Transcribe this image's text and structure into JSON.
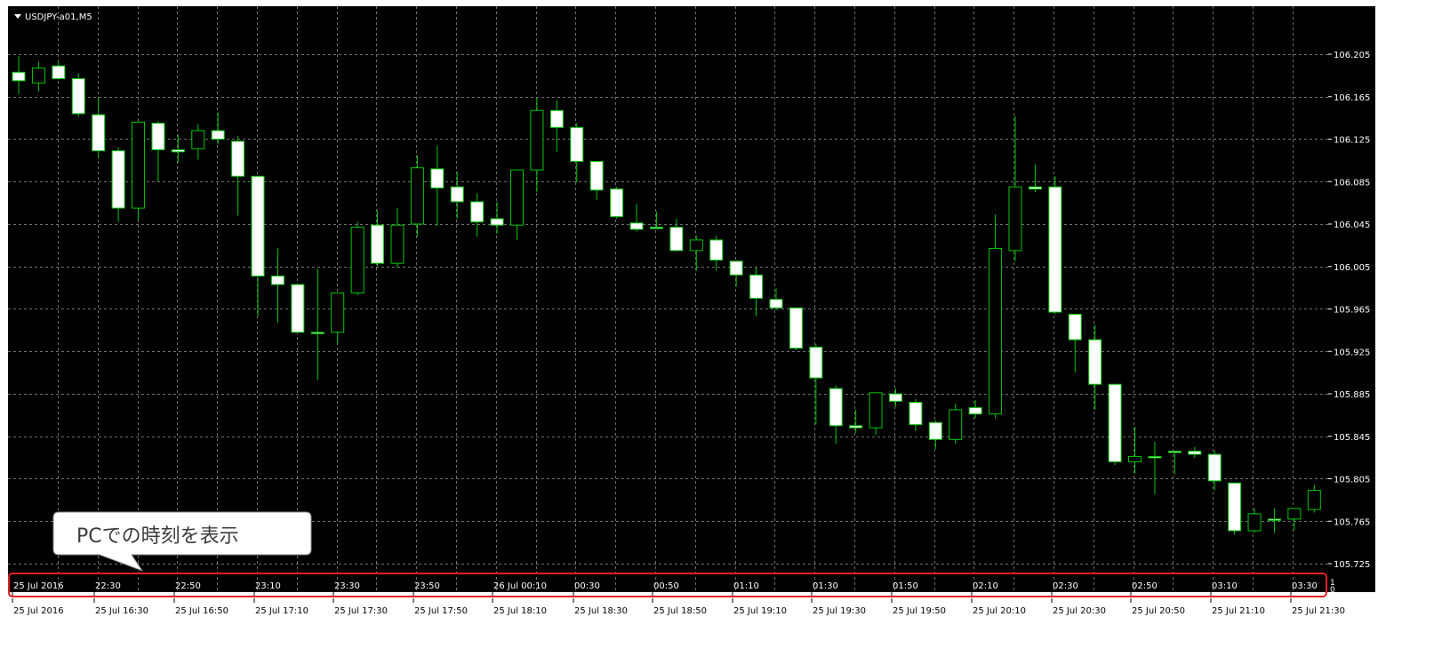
{
  "window": {
    "title": "USDJPY-a01,M5"
  },
  "callout": {
    "text": "PCでの時刻を表示"
  },
  "colors": {
    "background": "#000000",
    "grid": "#6f6f6f",
    "candle_up_body": "#000000",
    "candle_down_body": "#ffffff",
    "candle_outline": "#00c800",
    "highlight": "#e02020",
    "axis_text": "#ffffff",
    "bottom_text": "#000000"
  },
  "subwindow_scale": [
    "1",
    "0"
  ],
  "chart_data": {
    "type": "candlestick",
    "symbol": "USDJPY-a01",
    "timeframe": "M5",
    "grid": true,
    "y_tick_labels": [
      "106.205",
      "106.165",
      "106.125",
      "106.085",
      "106.045",
      "106.005",
      "105.965",
      "105.925",
      "105.885",
      "105.845",
      "105.805",
      "105.765",
      "105.725"
    ],
    "ylim": [
      105.721,
      106.219
    ],
    "pc_time_labels": [
      "25 Jul 2016",
      "22:30",
      "22:50",
      "23:10",
      "23:30",
      "23:50",
      "26 Jul 00:10",
      "00:30",
      "00:50",
      "01:10",
      "01:30",
      "01:50",
      "02:10",
      "02:30",
      "02:50",
      "03:10",
      "03:30"
    ],
    "server_time_labels": [
      "25 Jul 2016",
      "25 Jul 16:30",
      "25 Jul 16:50",
      "25 Jul 17:10",
      "25 Jul 17:30",
      "25 Jul 17:50",
      "25 Jul 18:10",
      "25 Jul 18:30",
      "25 Jul 18:50",
      "25 Jul 19:10",
      "25 Jul 19:30",
      "25 Jul 19:50",
      "25 Jul 20:10",
      "25 Jul 20:30",
      "25 Jul 20:50",
      "25 Jul 21:10",
      "25 Jul 21:30"
    ],
    "candles": [
      {
        "o": 106.188,
        "h": 106.203,
        "l": 106.167,
        "c": 106.18
      },
      {
        "o": 106.178,
        "h": 106.198,
        "l": 106.17,
        "c": 106.192
      },
      {
        "o": 106.194,
        "h": 106.198,
        "l": 106.181,
        "c": 106.182
      },
      {
        "o": 106.182,
        "h": 106.187,
        "l": 106.146,
        "c": 106.149
      },
      {
        "o": 106.148,
        "h": 106.164,
        "l": 106.107,
        "c": 106.114
      },
      {
        "o": 106.114,
        "h": 106.117,
        "l": 106.047,
        "c": 106.06
      },
      {
        "o": 106.06,
        "h": 106.142,
        "l": 106.049,
        "c": 106.141
      },
      {
        "o": 106.14,
        "h": 106.142,
        "l": 106.085,
        "c": 106.115
      },
      {
        "o": 106.115,
        "h": 106.129,
        "l": 106.103,
        "c": 106.113
      },
      {
        "o": 106.116,
        "h": 106.139,
        "l": 106.106,
        "c": 106.133
      },
      {
        "o": 106.133,
        "h": 106.15,
        "l": 106.12,
        "c": 106.125
      },
      {
        "o": 106.123,
        "h": 106.128,
        "l": 106.053,
        "c": 106.09
      },
      {
        "o": 106.09,
        "h": 106.09,
        "l": 105.958,
        "c": 105.996
      },
      {
        "o": 105.996,
        "h": 106.022,
        "l": 105.952,
        "c": 105.988
      },
      {
        "o": 105.988,
        "h": 105.988,
        "l": 105.943,
        "c": 105.943
      },
      {
        "o": 105.943,
        "h": 106.003,
        "l": 105.898,
        "c": 105.943
      },
      {
        "o": 105.943,
        "h": 105.978,
        "l": 105.932,
        "c": 105.98
      },
      {
        "o": 105.98,
        "h": 106.047,
        "l": 105.978,
        "c": 106.042
      },
      {
        "o": 106.044,
        "h": 106.058,
        "l": 106.005,
        "c": 106.008
      },
      {
        "o": 106.008,
        "h": 106.06,
        "l": 106.004,
        "c": 106.044
      },
      {
        "o": 106.045,
        "h": 106.11,
        "l": 106.033,
        "c": 106.098
      },
      {
        "o": 106.097,
        "h": 106.119,
        "l": 106.043,
        "c": 106.079
      },
      {
        "o": 106.08,
        "h": 106.094,
        "l": 106.05,
        "c": 106.066
      },
      {
        "o": 106.066,
        "h": 106.074,
        "l": 106.033,
        "c": 106.047
      },
      {
        "o": 106.05,
        "h": 106.066,
        "l": 106.036,
        "c": 106.044
      },
      {
        "o": 106.044,
        "h": 106.096,
        "l": 106.03,
        "c": 106.096
      },
      {
        "o": 106.096,
        "h": 106.164,
        "l": 106.075,
        "c": 106.152
      },
      {
        "o": 106.152,
        "h": 106.162,
        "l": 106.113,
        "c": 106.136
      },
      {
        "o": 106.136,
        "h": 106.14,
        "l": 106.084,
        "c": 106.104
      },
      {
        "o": 106.104,
        "h": 106.104,
        "l": 106.068,
        "c": 106.077
      },
      {
        "o": 106.078,
        "h": 106.08,
        "l": 106.05,
        "c": 106.052
      },
      {
        "o": 106.046,
        "h": 106.064,
        "l": 106.038,
        "c": 106.04
      },
      {
        "o": 106.042,
        "h": 106.057,
        "l": 106.042,
        "c": 106.042
      },
      {
        "o": 106.042,
        "h": 106.05,
        "l": 106.019,
        "c": 106.02
      },
      {
        "o": 106.02,
        "h": 106.034,
        "l": 106.001,
        "c": 106.03
      },
      {
        "o": 106.03,
        "h": 106.034,
        "l": 106.001,
        "c": 106.011
      },
      {
        "o": 106.01,
        "h": 106.01,
        "l": 105.986,
        "c": 105.997
      },
      {
        "o": 105.997,
        "h": 106.004,
        "l": 105.958,
        "c": 105.975
      },
      {
        "o": 105.974,
        "h": 105.984,
        "l": 105.964,
        "c": 105.966
      },
      {
        "o": 105.966,
        "h": 105.966,
        "l": 105.926,
        "c": 105.928
      },
      {
        "o": 105.929,
        "h": 105.932,
        "l": 105.856,
        "c": 105.9
      },
      {
        "o": 105.89,
        "h": 105.893,
        "l": 105.838,
        "c": 105.855
      },
      {
        "o": 105.855,
        "h": 105.87,
        "l": 105.848,
        "c": 105.853
      },
      {
        "o": 105.853,
        "h": 105.886,
        "l": 105.846,
        "c": 105.886
      },
      {
        "o": 105.885,
        "h": 105.89,
        "l": 105.873,
        "c": 105.878
      },
      {
        "o": 105.877,
        "h": 105.88,
        "l": 105.85,
        "c": 105.856
      },
      {
        "o": 105.858,
        "h": 105.86,
        "l": 105.833,
        "c": 105.842
      },
      {
        "o": 105.842,
        "h": 105.876,
        "l": 105.838,
        "c": 105.87
      },
      {
        "o": 105.872,
        "h": 105.879,
        "l": 105.862,
        "c": 105.866
      },
      {
        "o": 105.866,
        "h": 106.054,
        "l": 105.862,
        "c": 106.022
      },
      {
        "o": 106.02,
        "h": 106.147,
        "l": 106.01,
        "c": 106.08
      },
      {
        "o": 106.08,
        "h": 106.101,
        "l": 106.075,
        "c": 106.078
      },
      {
        "o": 106.08,
        "h": 106.09,
        "l": 105.96,
        "c": 105.962
      },
      {
        "o": 105.96,
        "h": 105.96,
        "l": 105.905,
        "c": 105.936
      },
      {
        "o": 105.936,
        "h": 105.95,
        "l": 105.87,
        "c": 105.894
      },
      {
        "o": 105.894,
        "h": 105.894,
        "l": 105.818,
        "c": 105.821
      },
      {
        "o": 105.821,
        "h": 105.854,
        "l": 105.81,
        "c": 105.826
      },
      {
        "o": 105.826,
        "h": 105.84,
        "l": 105.79,
        "c": 105.825
      },
      {
        "o": 105.831,
        "h": 105.831,
        "l": 105.809,
        "c": 105.831
      },
      {
        "o": 105.831,
        "h": 105.835,
        "l": 105.825,
        "c": 105.828
      },
      {
        "o": 105.828,
        "h": 105.832,
        "l": 105.794,
        "c": 105.803
      },
      {
        "o": 105.801,
        "h": 105.801,
        "l": 105.752,
        "c": 105.756
      },
      {
        "o": 105.756,
        "h": 105.777,
        "l": 105.754,
        "c": 105.772
      },
      {
        "o": 105.767,
        "h": 105.777,
        "l": 105.754,
        "c": 105.767
      },
      {
        "o": 105.767,
        "h": 105.777,
        "l": 105.757,
        "c": 105.777
      },
      {
        "o": 105.776,
        "h": 105.799,
        "l": 105.773,
        "c": 105.794
      }
    ]
  }
}
